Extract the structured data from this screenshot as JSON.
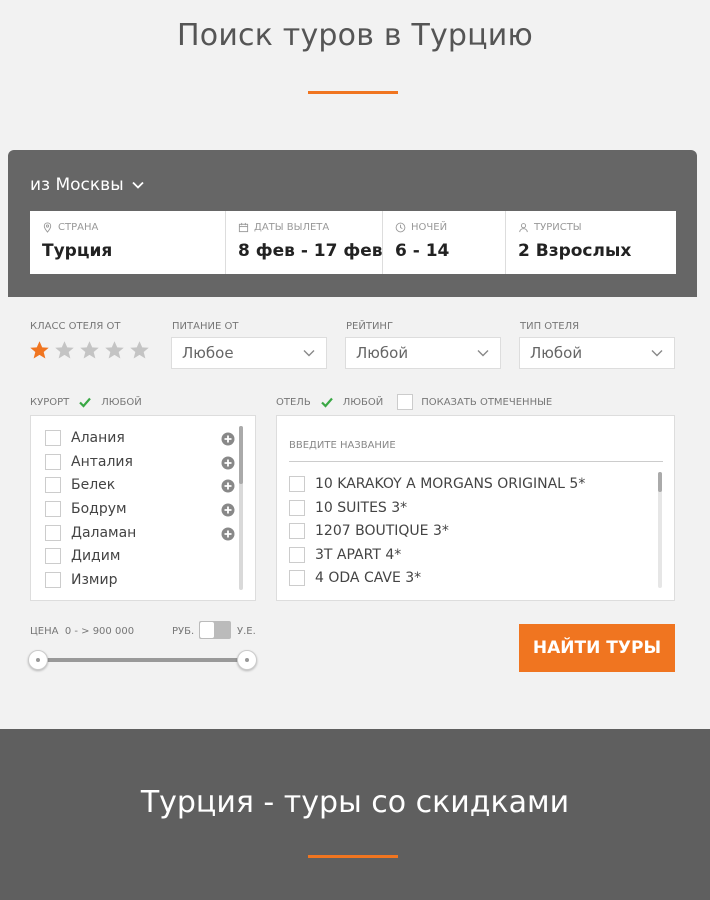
{
  "header": {
    "title": "Поиск туров в Турцию"
  },
  "search": {
    "origin": "из Москвы",
    "fields": [
      {
        "label": "страна",
        "value": "Турция",
        "icon": "location-pin-icon"
      },
      {
        "label": "даты вылета",
        "value": "8 фев - 17 фев",
        "icon": "calendar-icon"
      },
      {
        "label": "ночей",
        "value": "6 - 14",
        "icon": "clock-icon"
      },
      {
        "label": "туристы",
        "value": "2 Взрослых",
        "icon": "person-icon"
      }
    ]
  },
  "filters": {
    "hotel_class": {
      "label": "класс отеля от",
      "stars_selected": 1,
      "stars_total": 5
    },
    "meal": {
      "label": "питание от",
      "value": "Любое"
    },
    "rating": {
      "label": "рейтинг",
      "value": "Любой"
    },
    "hotel_type": {
      "label": "тип отеля",
      "value": "Любой"
    }
  },
  "resort": {
    "label": "курорт",
    "any_label": "любой",
    "any_checked": true,
    "items": [
      "Алания",
      "Анталия",
      "Белек",
      "Бодрум",
      "Даламан",
      "Дидим",
      "Измир"
    ],
    "expandable": [
      true,
      true,
      true,
      true,
      true,
      false,
      false
    ]
  },
  "hotel": {
    "label": "отель",
    "any_label": "любой",
    "any_checked": true,
    "show_marked_label": "показать отмеченные",
    "search_placeholder": "введите название",
    "items": [
      "10 KARAKOY A MORGANS ORIGINAL 5*",
      "10 SUITES 3*",
      "1207 BOUTIQUE 3*",
      "3T APART 4*",
      "4 ODA CAVE 3*"
    ]
  },
  "price": {
    "label": "цена",
    "range": "0 -  > 900 000",
    "currency_left": "руб.",
    "currency_right": "у.е."
  },
  "search_button": "НАЙТИ ТУРЫ",
  "footer": {
    "title": "Турция - туры со скидками"
  },
  "colors": {
    "accent": "#f07520",
    "panel": "#666666",
    "footer": "#5f5f5f",
    "check": "#3aa845"
  }
}
